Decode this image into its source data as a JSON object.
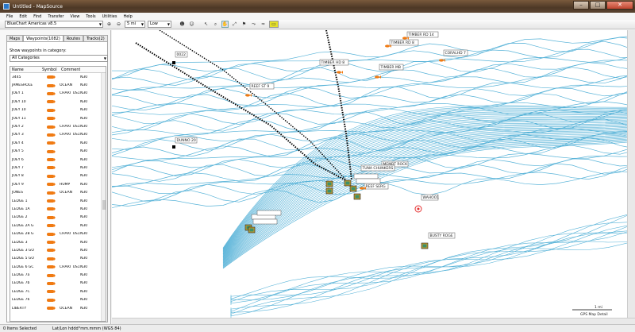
{
  "window": {
    "title": "Untitled - MapSource"
  },
  "menu": [
    "File",
    "Edit",
    "Find",
    "Transfer",
    "View",
    "Tools",
    "Utilities",
    "Help"
  ],
  "toolbar": {
    "product": "BlueChart Americas v8.5",
    "zoom": "5 mi",
    "detail": "Low"
  },
  "tabs": [
    "Maps",
    "Waypoints(1082)",
    "Routes",
    "Tracks(2)"
  ],
  "panel": {
    "show_label": "Show waypoints in category:",
    "category": "All Categories",
    "columns": [
      "Name",
      "Symbol",
      "Comment",
      ""
    ],
    "rows": [
      {
        "name": "3445",
        "comment": "",
        "extra": "N30"
      },
      {
        "name": "JAMESHOLE",
        "comment": "OCEAN",
        "extra": "N30"
      },
      {
        "name": "JOEY 1",
        "comment": "CHART US11382",
        "extra": "N30"
      },
      {
        "name": "JOEY 10",
        "comment": "",
        "extra": "N30"
      },
      {
        "name": "JOEY 10",
        "comment": "",
        "extra": "N30"
      },
      {
        "name": "JOEY 11",
        "comment": "",
        "extra": "N30"
      },
      {
        "name": "JOEY 2",
        "comment": "CHART US11382",
        "extra": "N30"
      },
      {
        "name": "JOEY 3",
        "comment": "CHART US11382",
        "extra": "N30"
      },
      {
        "name": "JOEY 4",
        "comment": "",
        "extra": "N30"
      },
      {
        "name": "JOEY 5",
        "comment": "",
        "extra": "N30"
      },
      {
        "name": "JOEY 6",
        "comment": "",
        "extra": "N30"
      },
      {
        "name": "JOEY 7",
        "comment": "",
        "extra": "N30"
      },
      {
        "name": "JOEY 8",
        "comment": "",
        "extra": "N30"
      },
      {
        "name": "JOEY 9",
        "comment": "HUMP",
        "extra": "N30"
      },
      {
        "name": "JONES",
        "comment": "OCEAN",
        "extra": "N30"
      },
      {
        "name": "LEDGE 1",
        "comment": "",
        "extra": "N30"
      },
      {
        "name": "LEDGE 1A",
        "comment": "",
        "extra": "N30"
      },
      {
        "name": "LEDGE 2",
        "comment": "",
        "extra": "N30"
      },
      {
        "name": "LEDGE 2A G",
        "comment": "",
        "extra": "N30"
      },
      {
        "name": "LEDGE 2B G",
        "comment": "CHART US11382",
        "extra": "N30"
      },
      {
        "name": "LEDGE 3",
        "comment": "",
        "extra": "N30"
      },
      {
        "name": "LEDGE 3 GO",
        "comment": "",
        "extra": "N30"
      },
      {
        "name": "LEDGE 5 GO",
        "comment": "",
        "extra": "N30"
      },
      {
        "name": "LEDGE 6 GC",
        "comment": "CHART US11382",
        "extra": "N30"
      },
      {
        "name": "LEDGE 7a",
        "comment": "",
        "extra": "N30"
      },
      {
        "name": "LEDGE 7b",
        "comment": "",
        "extra": "N30"
      },
      {
        "name": "LEDGE 7C",
        "comment": "",
        "extra": "N30"
      },
      {
        "name": "LEDGE 76",
        "comment": "",
        "extra": "N30"
      },
      {
        "name": "LIBERTY",
        "comment": "OCEAN",
        "extra": "N30"
      }
    ]
  },
  "map": {
    "waypoints": [
      "TIMBER RD 14",
      "TIMBER RD 8",
      "CORALHD 7",
      "TIMBER HD 8",
      "TIMBER MB",
      "REEF ST 9",
      "DUNNO 20",
      "MEMBT ROCK",
      "TUNA CHUNKERS",
      "REEF SERG",
      "WAHOO1",
      "BUSTY ROGE",
      "0022"
    ],
    "scale_label": "1 mi",
    "detail_label": "GPS Map Detail"
  },
  "status": {
    "selected": "0 Items Selected",
    "format": "Lat/Lon hddd°mm.mmm (WGS 84)"
  },
  "colors": {
    "contour": "#58b3d8",
    "symbol": "#f07a12",
    "title_bar": "#5a4330"
  }
}
